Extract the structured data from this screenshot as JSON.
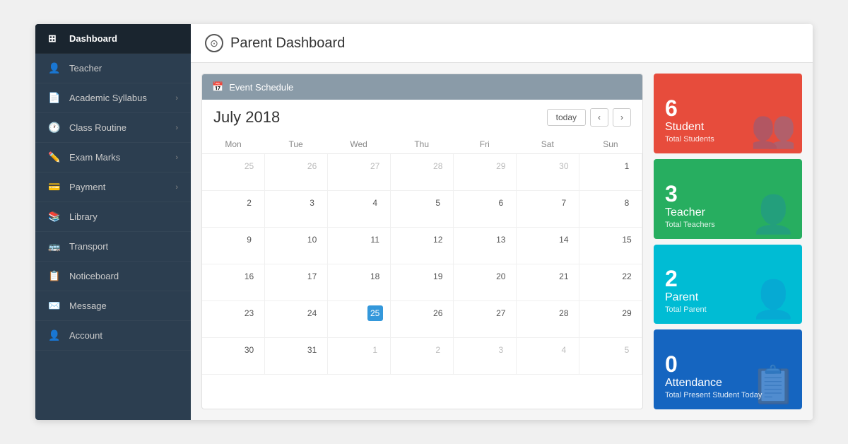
{
  "sidebar": {
    "items": [
      {
        "id": "dashboard",
        "label": "Dashboard",
        "icon": "⊞",
        "active": true,
        "hasChevron": false
      },
      {
        "id": "teacher",
        "label": "Teacher",
        "icon": "👤",
        "active": false,
        "hasChevron": false
      },
      {
        "id": "academic-syllabus",
        "label": "Academic Syllabus",
        "icon": "📄",
        "active": false,
        "hasChevron": true
      },
      {
        "id": "class-routine",
        "label": "Class Routine",
        "icon": "🕐",
        "active": false,
        "hasChevron": true
      },
      {
        "id": "exam-marks",
        "label": "Exam Marks",
        "icon": "✏️",
        "active": false,
        "hasChevron": true
      },
      {
        "id": "payment",
        "label": "Payment",
        "icon": "💳",
        "active": false,
        "hasChevron": true
      },
      {
        "id": "library",
        "label": "Library",
        "icon": "📚",
        "active": false,
        "hasChevron": false
      },
      {
        "id": "transport",
        "label": "Transport",
        "icon": "🚌",
        "active": false,
        "hasChevron": false
      },
      {
        "id": "noticeboard",
        "label": "Noticeboard",
        "icon": "📋",
        "active": false,
        "hasChevron": false
      },
      {
        "id": "message",
        "label": "Message",
        "icon": "✉️",
        "active": false,
        "hasChevron": false
      },
      {
        "id": "account",
        "label": "Account",
        "icon": "👤",
        "active": false,
        "hasChevron": false
      }
    ]
  },
  "header": {
    "title": "Parent Dashboard",
    "icon": "⊙"
  },
  "calendar": {
    "section_title": "Event Schedule",
    "month_year": "July 2018",
    "today_btn": "today",
    "days": [
      "Mon",
      "Tue",
      "Wed",
      "Thu",
      "Fri",
      "Sat",
      "Sun"
    ],
    "weeks": [
      [
        "25",
        "26",
        "27",
        "28",
        "29",
        "30",
        "1"
      ],
      [
        "2",
        "3",
        "4",
        "5",
        "6",
        "7",
        "8"
      ],
      [
        "9",
        "10",
        "11",
        "12",
        "13",
        "14",
        "15"
      ],
      [
        "16",
        "17",
        "18",
        "19",
        "20",
        "21",
        "22"
      ],
      [
        "23",
        "24",
        "25",
        "26",
        "27",
        "28",
        "29"
      ],
      [
        "30",
        "31",
        "1",
        "2",
        "3",
        "4",
        "5"
      ]
    ],
    "today_date": "25",
    "today_week_index": 4,
    "today_day_index": 2
  },
  "stats": [
    {
      "id": "student",
      "number": "6",
      "label": "Student",
      "sub": "Total Students",
      "color_class": "card-red",
      "bg_icon": "👥"
    },
    {
      "id": "teacher",
      "number": "3",
      "label": "Teacher",
      "sub": "Total Teachers",
      "color_class": "card-green",
      "bg_icon": "👤"
    },
    {
      "id": "parent",
      "number": "2",
      "label": "Parent",
      "sub": "Total Parent",
      "color_class": "card-cyan",
      "bg_icon": "👤"
    },
    {
      "id": "attendance",
      "number": "0",
      "label": "Attendance",
      "sub": "Total Present Student Today",
      "color_class": "card-blue",
      "bg_icon": "📋"
    }
  ]
}
